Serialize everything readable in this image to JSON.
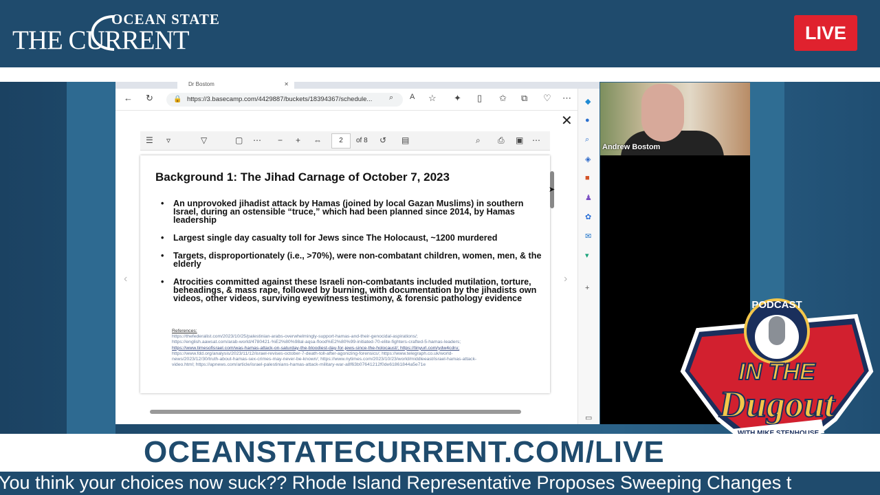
{
  "header": {
    "logo_top": "OCEAN STATE",
    "logo_bottom": "THE CURRENT",
    "live_badge": "LIVE"
  },
  "browser": {
    "tab_title": "Dr Bostom",
    "url": "https://3.basecamp.com/4429887/buckets/18394367/schedule...",
    "pdf_toolbar": {
      "page_number": "2",
      "page_total": "of 8"
    }
  },
  "slide": {
    "title": "Background 1: The Jihad Carnage of October 7, 2023",
    "bullets": [
      "An unprovoked jihadist attack by Hamas (joined by local Gazan Muslims) in southern Israel, during an ostensible “truce,” which had been planned since 2014, by Hamas leadership",
      "Largest single day casualty toll for Jews since The Holocaust, ~1200 murdered",
      "Targets, disproportionately (i.e., >70%), were non-combatant children, women, men, & the elderly",
      "Atrocities committed against these Israeli non-combatants included mutilation, torture, beheadings, & mass rape, followed by burning, with documentation by  the jihadists own videos, other videos, surviving eyewitness testimony, & forensic pathology evidence"
    ],
    "references_heading": "References:",
    "references": [
      "https://thefederalist.com/2023/10/25/palestinian-arabs-overwhelmingly-support-hamas-and-their-genocidal-aspirations/;",
      "https://english.aawsat.com/arab-world/4780421-%E2%80%98al-aqsa-flood%E2%80%99-initiated-70-elite-fighters-crafted-5-hamas-leaders;",
      "https://www.timesofisrael.com/was-hamas-attack-on-saturday-the-bloodiest-day-for-jews-since-the-holocaust/; https://tinyurl.com/ydw4cdru;",
      "https://www.fdd.org/analysis/2023/11/12/israel-revises-october-7-death-toll-after-agonizing-forensics/; https://www.telegraph.co.uk/world-",
      "news/2023/12/30/truth-about-hamas-sex-crimes-may-never-be-known/; https://www.nytimes.com/2023/10/23/world/middleeast/israel-hamas-attack-",
      "video.html; https://apnews.com/article/israel-palestinians-hamas-attack-military-war-a8f63b07641212f0de61861844a5e71e"
    ]
  },
  "webcam": {
    "participant_name": "Andrew Bostom"
  },
  "podcast_badge": {
    "top_text": "PODCAST",
    "line1": "IN THE",
    "line2": "Dugout",
    "host": "WITH MIKE STENHOUSE"
  },
  "footer": {
    "url_text": "OCEANSTATECURRENT.COM/LIVE",
    "ticker": "You think your choices now suck?? Rhode Island Representative Proposes Sweeping Changes t"
  },
  "colors": {
    "brand_blue": "#1f4b6d",
    "live_red": "#e0222e",
    "badge_red": "#d2202f",
    "badge_gold": "#f3c64a"
  }
}
